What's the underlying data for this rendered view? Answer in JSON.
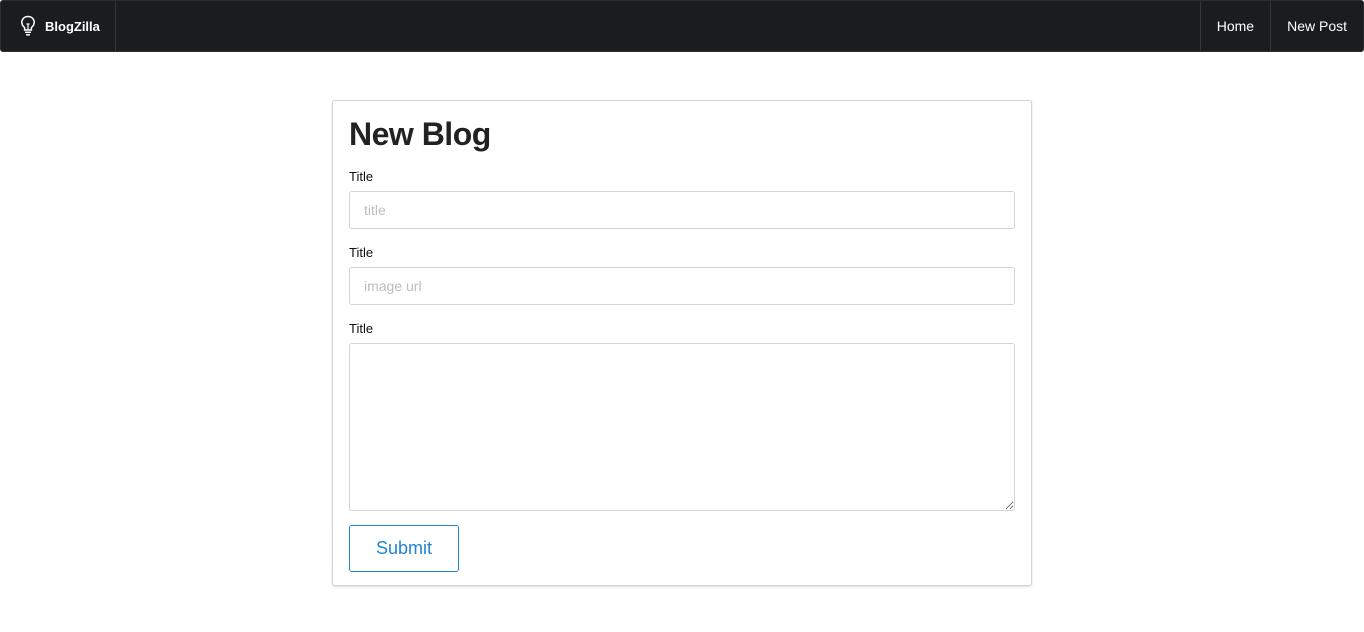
{
  "navbar": {
    "brand": {
      "icon": "lightbulb-icon",
      "label": "BlogZilla"
    },
    "items": [
      {
        "label": "Home"
      },
      {
        "label": "New Post"
      }
    ],
    "background": "#1b1c1d"
  },
  "form": {
    "heading": "New Blog",
    "fields": [
      {
        "label": "Title",
        "placeholder": "title",
        "value": ""
      },
      {
        "label": "Title",
        "placeholder": "image url",
        "value": ""
      },
      {
        "label": "Title",
        "value": ""
      }
    ],
    "submit_label": "Submit",
    "accent": "#2185d0"
  }
}
